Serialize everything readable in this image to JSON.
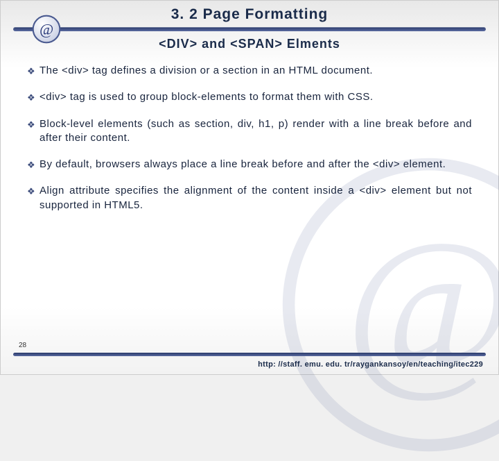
{
  "header": {
    "title": "3. 2 Page Formatting",
    "subtitle": "<DIV> and <SPAN> Elments"
  },
  "bullets": [
    "The <div> tag defines a division or a section in an HTML document.",
    "<div> tag is used to group block-elements to format them with CSS.",
    "Block-level elements (such as section, div, h1, p) render with a line break before and after their content.",
    "By default, browsers always place a line break before and after the <div> element.",
    "Align attribute specifies the alignment of the content inside a <div> element but not supported in HTML5."
  ],
  "footer": {
    "page_number": "28",
    "url": "http: //staff. emu. edu. tr/raygankansoy/en/teaching/itec229"
  },
  "icons": {
    "at": "at-sign-icon"
  }
}
